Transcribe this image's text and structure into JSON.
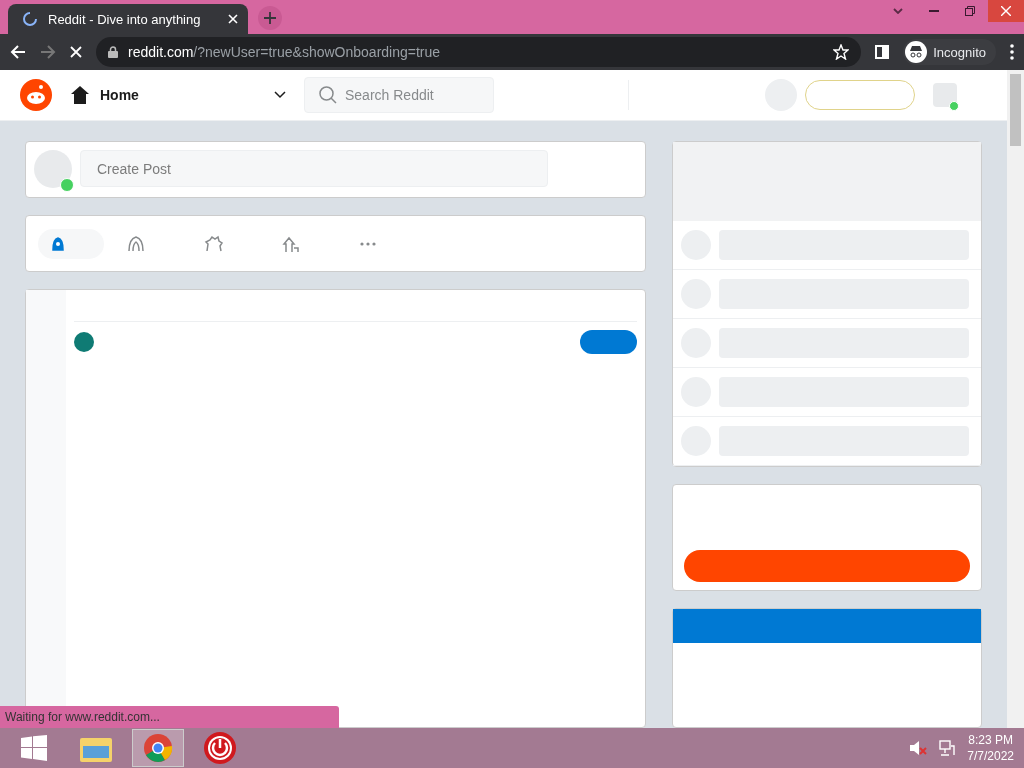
{
  "browser": {
    "tab": {
      "title": "Reddit - Dive into anything",
      "loading": true
    },
    "address": {
      "host": "reddit.com",
      "path": "/?newUser=true&showOnboarding=true"
    },
    "profile": "Incognito",
    "status": "Waiting for www.reddit.com..."
  },
  "header": {
    "feed": "Home",
    "search": {
      "placeholder": "Search Reddit"
    }
  },
  "create_post": {
    "placeholder": "Create Post"
  },
  "sort_tabs": [
    {
      "kind": "best",
      "selected": true
    },
    {
      "kind": "hot",
      "selected": false
    },
    {
      "kind": "new",
      "selected": false
    },
    {
      "kind": "top",
      "selected": false
    },
    {
      "kind": "more",
      "selected": false
    }
  ],
  "taskbar": {
    "time": "8:23 PM",
    "date": "7/7/2022"
  }
}
